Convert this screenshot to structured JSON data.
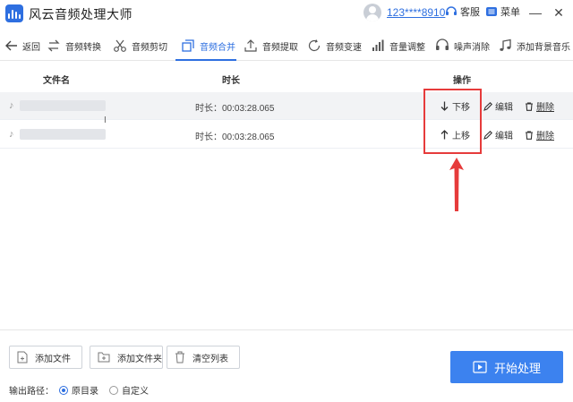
{
  "window": {
    "title": "风云音频处理大师",
    "username": "123****8910",
    "service_label": "客服",
    "menu_label": "菜单",
    "minimize_glyph": "—",
    "close_glyph": "✕"
  },
  "toolbar": {
    "back_label": "返回",
    "tools": [
      {
        "label": "音频转换",
        "icon": "swap-icon"
      },
      {
        "label": "音频剪切",
        "icon": "scissors-icon"
      },
      {
        "label": "音频合并",
        "icon": "merge-icon",
        "active": true
      },
      {
        "label": "音频提取",
        "icon": "extract-icon"
      },
      {
        "label": "音频变速",
        "icon": "speed-icon"
      },
      {
        "label": "音量调整",
        "icon": "volume-bars-icon"
      },
      {
        "label": "噪声消除",
        "icon": "noise-icon"
      },
      {
        "label": "添加背景音乐",
        "icon": "music-note-icon"
      }
    ],
    "accent_color": "#2e6fe0"
  },
  "table": {
    "headers": {
      "file_name": "文件名",
      "duration": "时长",
      "actions": "操作"
    },
    "rows": [
      {
        "duration": "时长：00:03:28.065",
        "move_label": "下移",
        "move_icon": "arrow-down-icon",
        "edit_label": "编辑",
        "delete_label": "删除"
      },
      {
        "duration": "时长：00:03:28.065",
        "move_label": "上移",
        "move_icon": "arrow-up-icon",
        "edit_label": "编辑",
        "delete_label": "删除"
      }
    ]
  },
  "annotation": {
    "color": "#e63b3b"
  },
  "bottom": {
    "add_file_label": "添加文件",
    "add_folder_label": "添加文件夹",
    "clear_list_label": "清空列表",
    "output_path_label": "输出路径：",
    "radio_original": "原目录",
    "radio_custom": "自定义",
    "selected_output": "原目录",
    "start_label": "开始处理",
    "start_color": "#3c82ef"
  }
}
